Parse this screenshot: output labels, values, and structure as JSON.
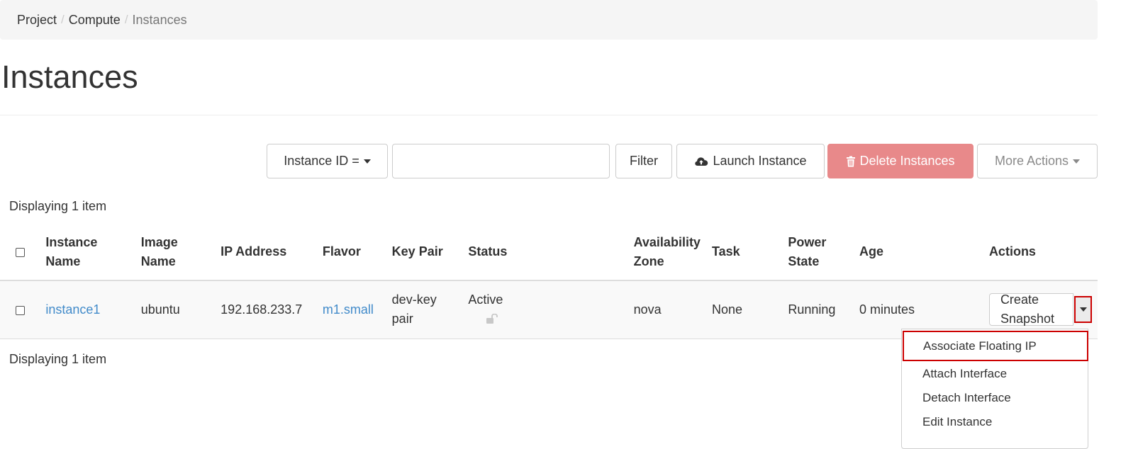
{
  "breadcrumb": {
    "items": [
      "Project",
      "Compute"
    ],
    "current": "Instances",
    "separator": "/"
  },
  "page": {
    "title": "Instances"
  },
  "toolbar": {
    "filter_field": "Instance ID =",
    "filter_value": "",
    "filter_button": "Filter",
    "launch_button": "Launch Instance",
    "delete_button": "Delete Instances",
    "more_actions": "More Actions"
  },
  "display_count": "Displaying 1 item",
  "table": {
    "headers": {
      "instance_name": "Instance Name",
      "image_name": "Image Name",
      "ip_address": "IP Address",
      "flavor": "Flavor",
      "key_pair": "Key Pair",
      "status": "Status",
      "availability_zone": "Availability Zone",
      "task": "Task",
      "power_state": "Power State",
      "age": "Age",
      "actions": "Actions"
    },
    "rows": [
      {
        "instance_name": "instance1",
        "image_name": "ubuntu",
        "ip_address": "192.168.233.7",
        "flavor": "m1.small",
        "key_pair": "dev-keypair",
        "status": "Active",
        "availability_zone": "nova",
        "task": "None",
        "power_state": "Running",
        "age": "0 minutes",
        "primary_action": "Create Snapshot"
      }
    ]
  },
  "action_menu": {
    "items": [
      "Associate Floating IP",
      "Attach Interface",
      "Detach Interface",
      "Edit Instance"
    ],
    "highlighted": "Associate Floating IP"
  },
  "colors": {
    "link": "#428bca",
    "danger_button": "#e8898a",
    "highlight_border": "#cc0000",
    "breadcrumb_bg": "#f5f5f5"
  },
  "icons": {
    "launch": "cloud-upload-icon",
    "delete": "trash-icon",
    "status_lock": "unlock-icon"
  }
}
